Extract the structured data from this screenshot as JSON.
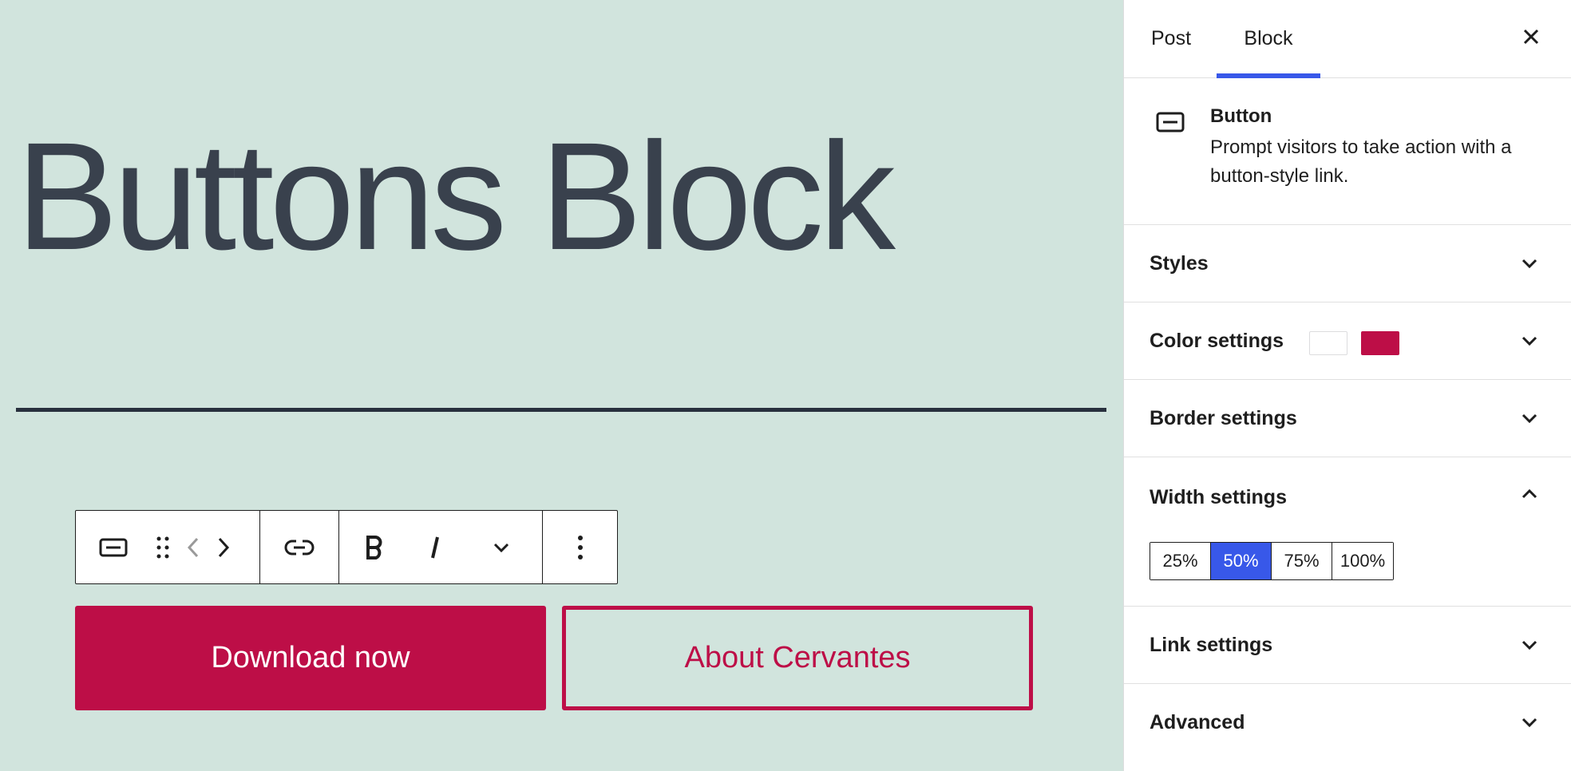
{
  "canvas": {
    "title": "Buttons Block",
    "background_color": "#d1e4dd",
    "buttons": [
      {
        "label": "Download now",
        "style": "fill",
        "color": "#bd0e47"
      },
      {
        "label": "About Cervantes",
        "style": "outline",
        "color": "#bd0e47"
      }
    ],
    "toolbar": {
      "icons": [
        "button-block-icon",
        "drag-handle-icon",
        "move-left-icon",
        "move-right-icon",
        "link-icon",
        "bold-icon",
        "italic-icon",
        "more-rich-text-chevron-icon",
        "more-options-icon"
      ]
    }
  },
  "sidebar": {
    "tabs": [
      {
        "label": "Post",
        "active": false
      },
      {
        "label": "Block",
        "active": true
      }
    ],
    "accent_color": "#3858e9",
    "block_card": {
      "title": "Button",
      "description": "Prompt visitors to take action with a button-style link."
    },
    "panels": {
      "styles": "Styles",
      "color": "Color settings",
      "border": "Border settings",
      "width": "Width settings",
      "link": "Link settings",
      "advanced": "Advanced"
    },
    "color_swatches": [
      "#ffffff",
      "#bd0e47"
    ],
    "width_options": [
      {
        "label": "25%",
        "active": false
      },
      {
        "label": "50%",
        "active": true
      },
      {
        "label": "75%",
        "active": false
      },
      {
        "label": "100%",
        "active": false
      }
    ]
  }
}
